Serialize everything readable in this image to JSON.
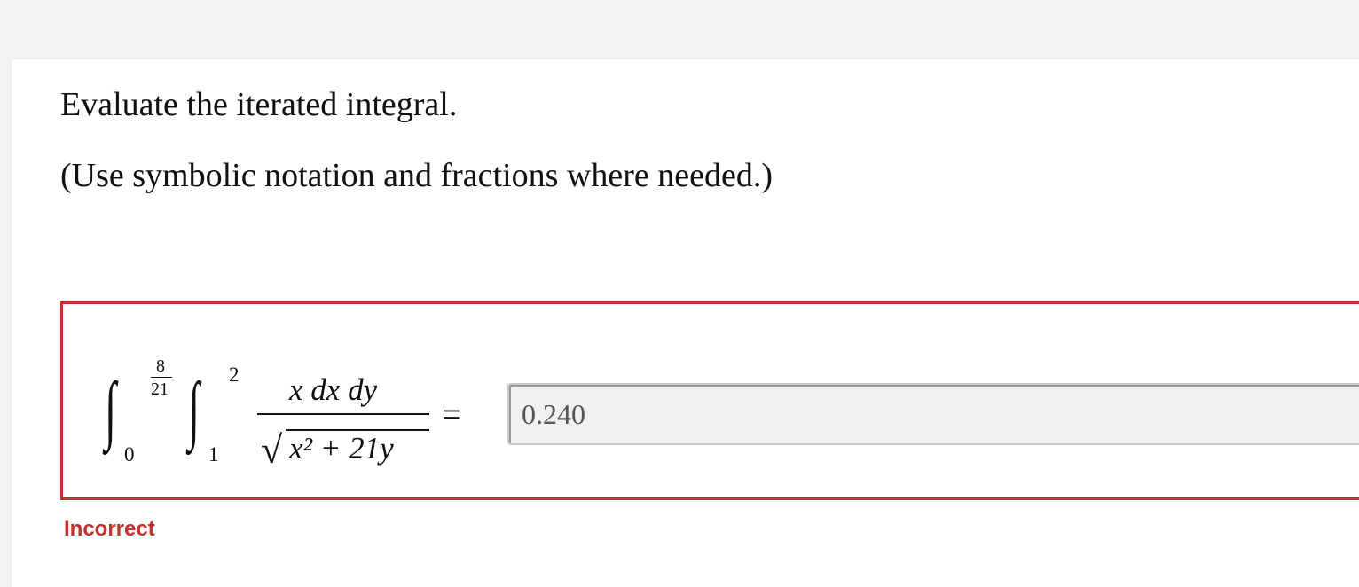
{
  "question": {
    "instruction": "Evaluate the iterated integral.",
    "hint": "(Use symbolic notation and fractions where needed.)"
  },
  "integral": {
    "outer_upper_num": "8",
    "outer_upper_den": "21",
    "outer_lower": "0",
    "inner_upper": "2",
    "inner_lower": "1",
    "numerator": "x dx dy",
    "denominator_radicand": "x² + 21y",
    "equals": "="
  },
  "answer": {
    "value": "0.240"
  },
  "feedback": {
    "status": "Incorrect"
  },
  "colors": {
    "page_background": "#f2f2f2",
    "card_background": "#ffffff",
    "error": "#c4302b",
    "input_background": "#f1f1f1"
  }
}
